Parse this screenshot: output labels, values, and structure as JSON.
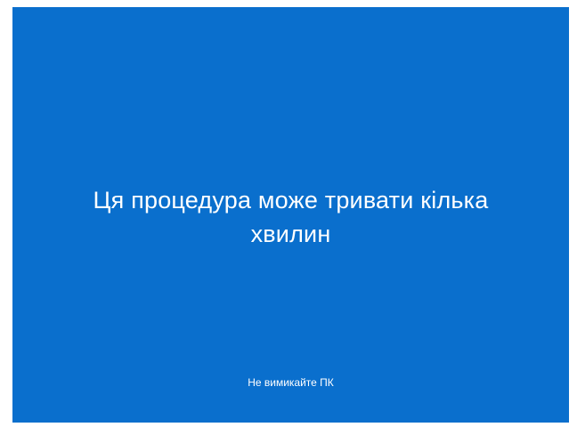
{
  "screen": {
    "background_color": "#0a6fcd",
    "text_color": "#ffffff",
    "message_line1": "Ця процедура може тривати кілька",
    "message_line2": "хвилин",
    "footer_note": "Не вимикайте ПК"
  }
}
